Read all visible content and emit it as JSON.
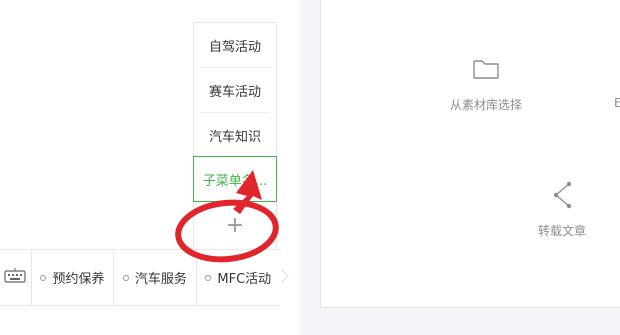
{
  "submenu": {
    "items": [
      {
        "label": "自驾活动"
      },
      {
        "label": "赛车活动"
      },
      {
        "label": "汽车知识"
      },
      {
        "label": "子菜单名..."
      }
    ],
    "add_symbol": "+"
  },
  "menu_bar": {
    "tabs": [
      {
        "label": "预约保养"
      },
      {
        "label": "汽车服务"
      },
      {
        "label": "MFC活动"
      }
    ]
  },
  "actions": {
    "material": {
      "label": "从素材库选择"
    },
    "reprint": {
      "label": "转载文章"
    },
    "edge_text": "E"
  },
  "colors": {
    "accent": "#44b549",
    "annotation": "#e0262b"
  },
  "icons": [
    "keyboard-icon",
    "folder-icon",
    "share-icon"
  ]
}
